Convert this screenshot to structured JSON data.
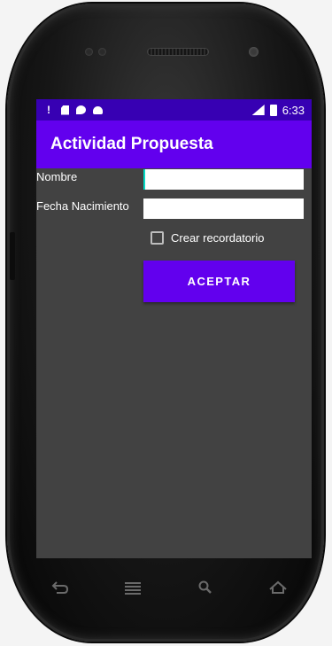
{
  "status_bar": {
    "left_icons": [
      "exclamation-icon",
      "sd-card-icon",
      "chat-icon",
      "android-icon"
    ],
    "signal_label": "LTE",
    "time": "6:33"
  },
  "app_bar": {
    "title": "Actividad Propuesta",
    "color": "#6200ee"
  },
  "form": {
    "nombre_label": "Nombre",
    "nombre_value": "",
    "fecha_label": "Fecha Nacimiento",
    "fecha_value": "",
    "checkbox_label": "Crear recordatorio",
    "checkbox_checked": false,
    "accept_label": "ACEPTAR"
  },
  "nav_bar": {
    "icons": [
      "back-icon",
      "menu-icon",
      "search-icon",
      "home-icon"
    ]
  },
  "colors": {
    "status_bar": "#3700b3",
    "primary": "#6200ee",
    "accent": "#03dac5",
    "background": "#424242"
  }
}
